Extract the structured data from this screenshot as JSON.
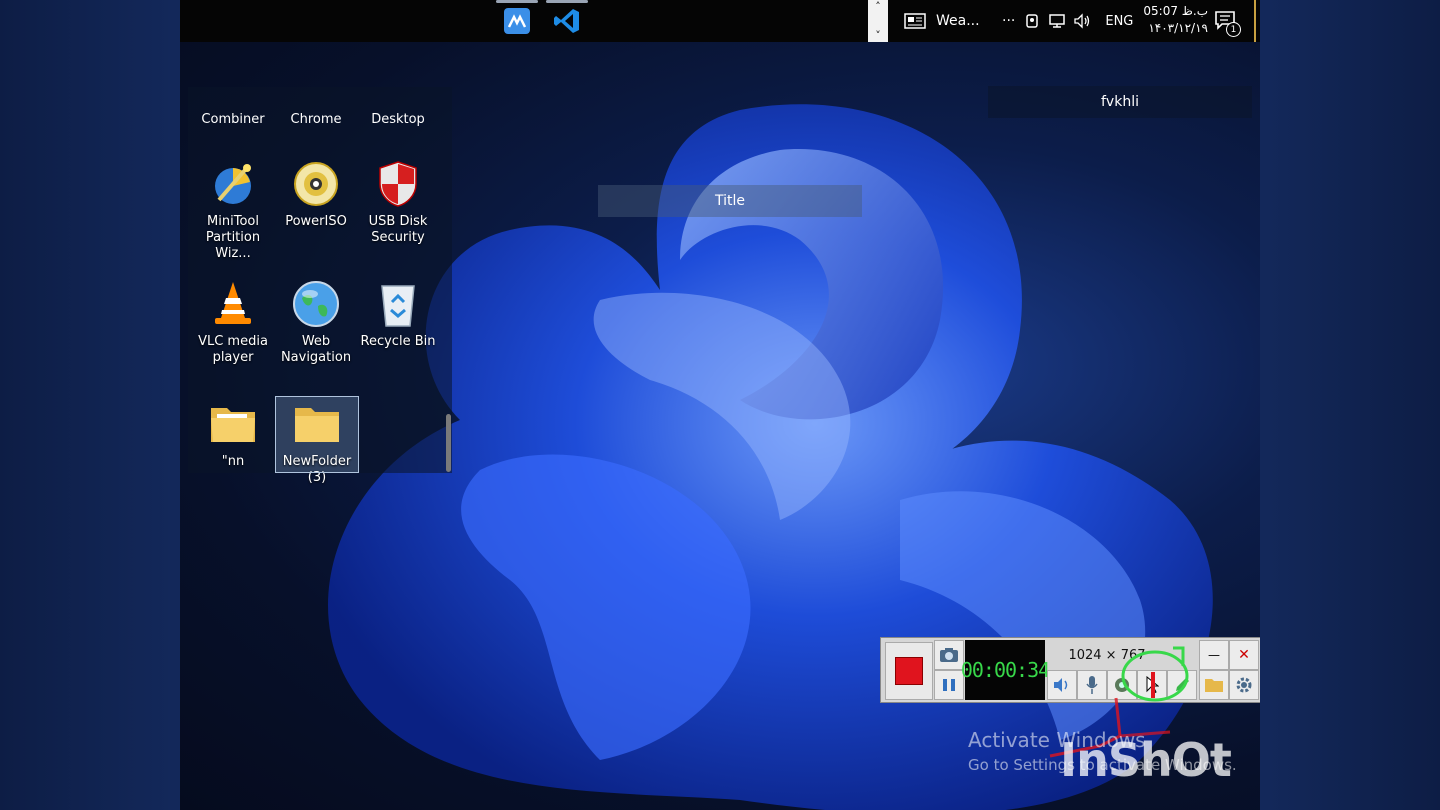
{
  "taskbar": {
    "apps": [
      {
        "name": "AnyDesk"
      },
      {
        "name": "Visual Studio Code"
      }
    ],
    "scroll_up": "˄",
    "scroll_down": "˅",
    "widget_label": "Wea...",
    "overflow": "···",
    "language": "ENG",
    "time": "05:07 ب.ظ",
    "date": "۱۴۰۳/۱۲/۱۹",
    "notification_count": "1"
  },
  "desktop": {
    "cut_labels": [
      "Combiner",
      "Chrome",
      "Desktop"
    ],
    "icons": [
      {
        "label": "MiniTool Partition Wiz...",
        "icon": "minitool-icon"
      },
      {
        "label": "PowerISO",
        "icon": "poweriso-icon"
      },
      {
        "label": "USB Disk Security",
        "icon": "shield-icon"
      },
      {
        "label": "VLC media player",
        "icon": "vlc-icon"
      },
      {
        "label": "Web Navigation",
        "icon": "globe-icon"
      },
      {
        "label": "Recycle Bin",
        "icon": "recycle-bin-icon"
      },
      {
        "label": "\"nn",
        "icon": "folder-icon"
      },
      {
        "label": "NewFolder (3)",
        "icon": "folder-icon"
      }
    ]
  },
  "overlays": {
    "title_box": "Title",
    "name_box": "fvkhli"
  },
  "recorder": {
    "timer": "00:00:34",
    "resolution": "1024 × 767",
    "minimize": "—",
    "close": "✕"
  },
  "watermark": {
    "activate_title": "Activate Windows",
    "activate_sub": "Go to Settings to activate Windows.",
    "brand": "InShOt"
  },
  "colors": {
    "record_red": "#e0141e",
    "timer_green": "#38d84a",
    "wallpaper_blue": "#1f4fe0"
  }
}
